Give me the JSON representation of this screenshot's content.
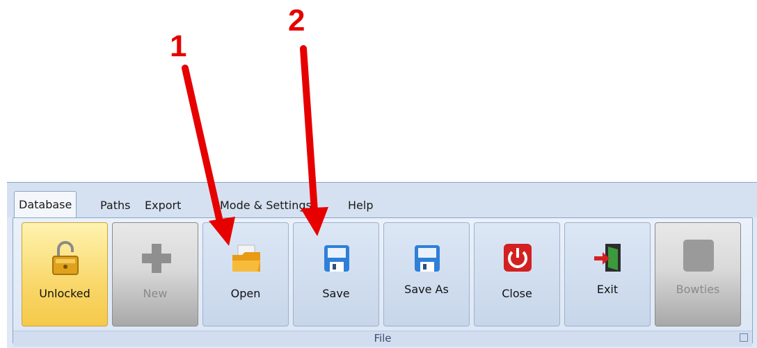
{
  "annotations": {
    "first": "1",
    "second": "2"
  },
  "tabs": [
    "Database",
    "Paths",
    "Export",
    "Mode & Settings",
    "Help"
  ],
  "buttons": {
    "unlocked": "Unlocked",
    "new": "New",
    "open": "Open",
    "save": "Save",
    "save_as": "Save As",
    "close": "Close",
    "exit": "Exit",
    "bowties": "Bowties"
  },
  "group_label": "File",
  "colors": {
    "annotation": "#e60000",
    "unlocked_bg": "#f9d76a",
    "save_blue": "#2f7fd8",
    "close_red": "#d32020"
  }
}
